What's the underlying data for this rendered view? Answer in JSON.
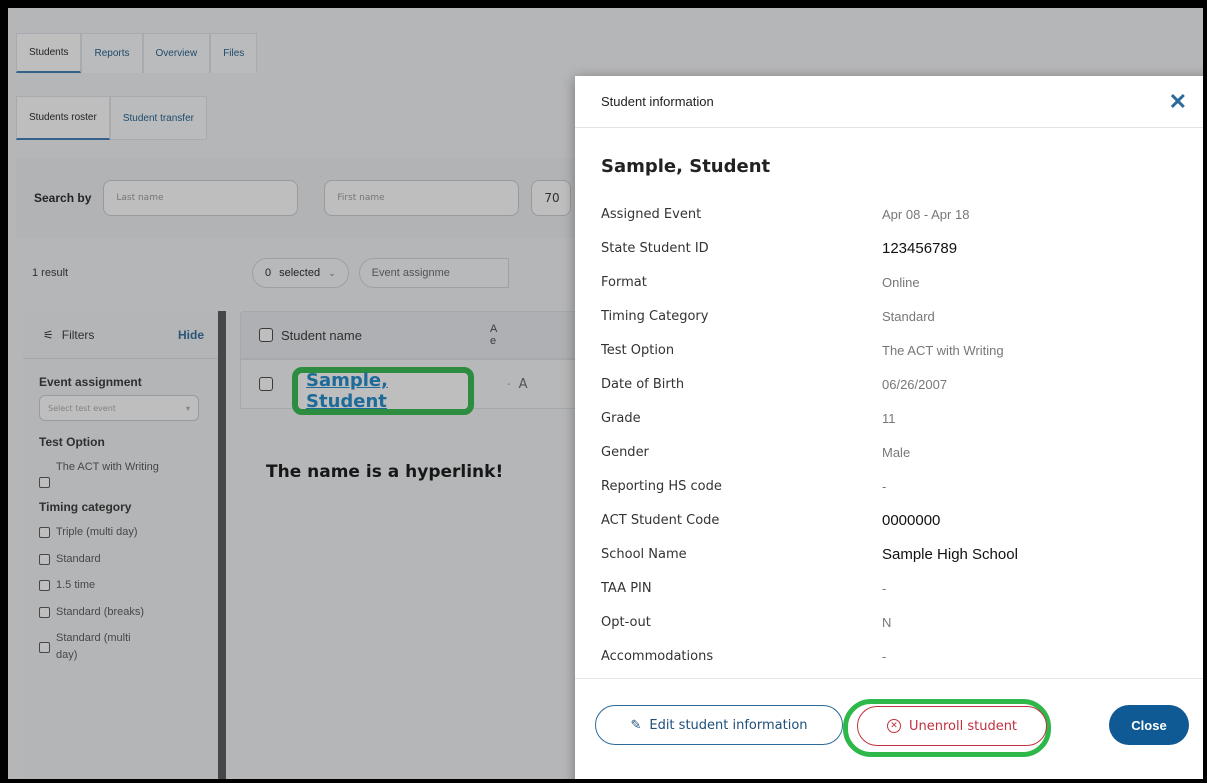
{
  "tabs": [
    "Students",
    "Reports",
    "Overview",
    "Files"
  ],
  "subtabs": [
    "Students roster",
    "Student transfer"
  ],
  "search": {
    "label": "Search by",
    "last_name_placeholder": "Last name",
    "first_name_placeholder": "First name",
    "third_field_partial": "70"
  },
  "results": {
    "count": "1 result",
    "selected_count": "0",
    "selected_label": "selected",
    "event_assignment_partial": "Event assignme"
  },
  "filters": {
    "title": "Filters",
    "hide": "Hide",
    "event_assignment_title": "Event assignment",
    "event_select_placeholder": "Select test event",
    "test_option_title": "Test Option",
    "test_options": [
      "The ACT with Writing"
    ],
    "timing_title": "Timing category",
    "timing_options": [
      "Triple (multi day)",
      "Standard",
      "1.5 time",
      "Standard (breaks)",
      "Standard (multi day)"
    ]
  },
  "table": {
    "col_student_name": "Student name",
    "col_partial": "A e",
    "row_name": "Sample, Student",
    "row_partial": "A"
  },
  "annotation": "The name is a hyperlink!",
  "modal": {
    "title": "Student information",
    "student_name": "Sample, Student",
    "fields": [
      {
        "label": "Assigned Event",
        "value": "Apr 08 - Apr 18"
      },
      {
        "label": "State Student ID",
        "value": "123456789"
      },
      {
        "label": "Format",
        "value": "Online"
      },
      {
        "label": "Timing Category",
        "value": "Standard"
      },
      {
        "label": "Test Option",
        "value": "The ACT with Writing"
      },
      {
        "label": "Date of Birth",
        "value": "06/26/2007"
      },
      {
        "label": "Grade",
        "value": "11"
      },
      {
        "label": "Gender",
        "value": "Male"
      },
      {
        "label": "Reporting HS code",
        "value": "-"
      },
      {
        "label": "ACT Student Code",
        "value": "0000000"
      },
      {
        "label": "School Name",
        "value": "Sample High School"
      },
      {
        "label": "TAA PIN",
        "value": "-"
      },
      {
        "label": "Opt-out",
        "value": "N"
      },
      {
        "label": "Accommodations",
        "value": "-"
      }
    ],
    "edit_button": "Edit student information",
    "unenroll_button": "Unenroll student",
    "close_button": "Close"
  },
  "colors": {
    "accent": "#2d6a9a",
    "highlight_green": "#2fb84a",
    "danger": "#c2303f",
    "primary_button": "#0f5a95",
    "link": "#1a87c9"
  }
}
